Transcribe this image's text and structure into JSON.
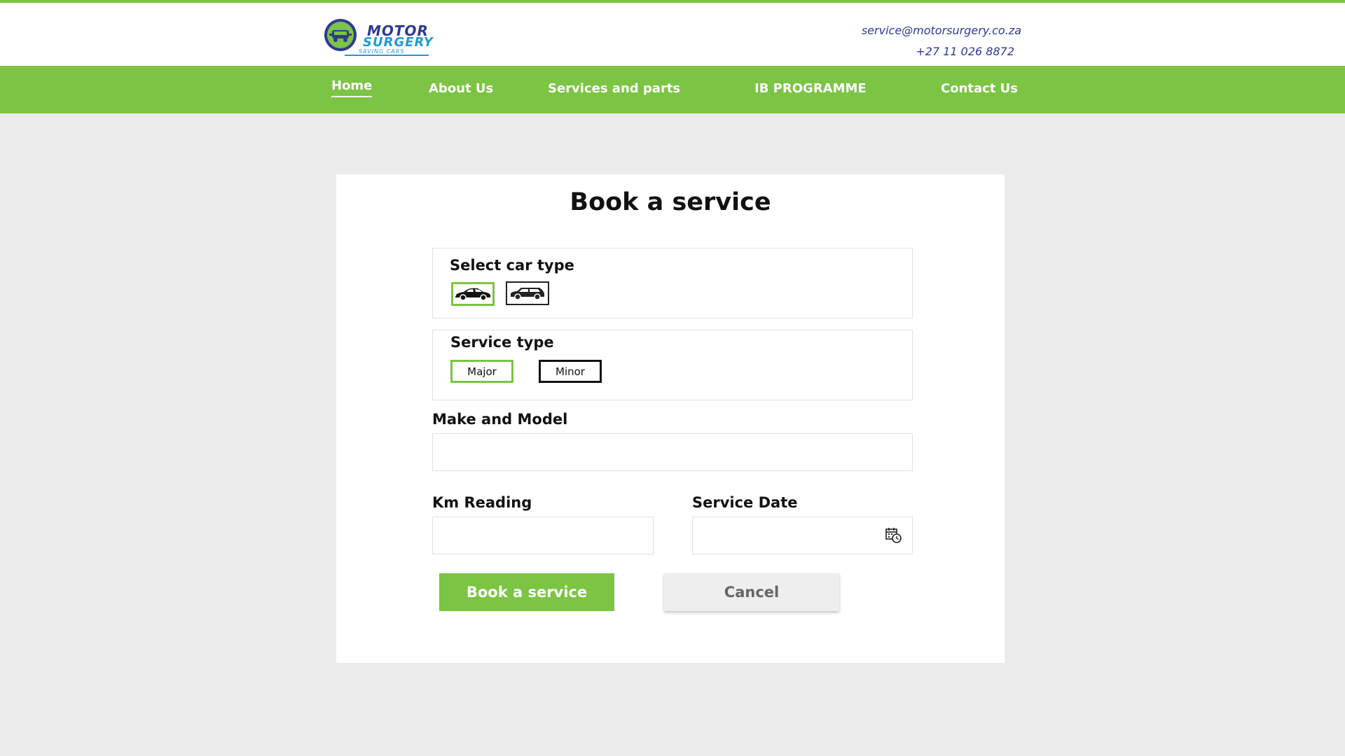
{
  "brand": {
    "name_line1": "MOTOR",
    "name_line2": "SURGERY",
    "tagline": "SAVING CARS",
    "accent": "#7cc443",
    "primary_text": "#2e3a94",
    "secondary": "#1f9bd6"
  },
  "contact": {
    "email": "service@motorsurgery.co.za",
    "phone": "+27 11 026 8872"
  },
  "nav": {
    "items": [
      {
        "label": "Home",
        "active": true
      },
      {
        "label": "About Us"
      },
      {
        "label": "Services and parts"
      },
      {
        "label": "IB PROGRAMME"
      },
      {
        "label": "Contact Us"
      }
    ]
  },
  "form": {
    "title": "Book a service",
    "car_type": {
      "label": "Select car type",
      "options": [
        {
          "icon": "sedan-icon",
          "selected": true
        },
        {
          "icon": "hatchback-icon",
          "selected": false
        }
      ]
    },
    "service_type": {
      "label": "Service type",
      "options": [
        {
          "label": "Major",
          "selected": true
        },
        {
          "label": "Minor",
          "selected": false
        }
      ]
    },
    "make_model": {
      "label": "Make and Model",
      "value": ""
    },
    "km_reading": {
      "label": "Km Reading",
      "value": ""
    },
    "service_date": {
      "label": "Service Date",
      "value": "",
      "icon": "calendar-clock-icon"
    },
    "submit_label": "Book a service",
    "cancel_label": "Cancel"
  }
}
